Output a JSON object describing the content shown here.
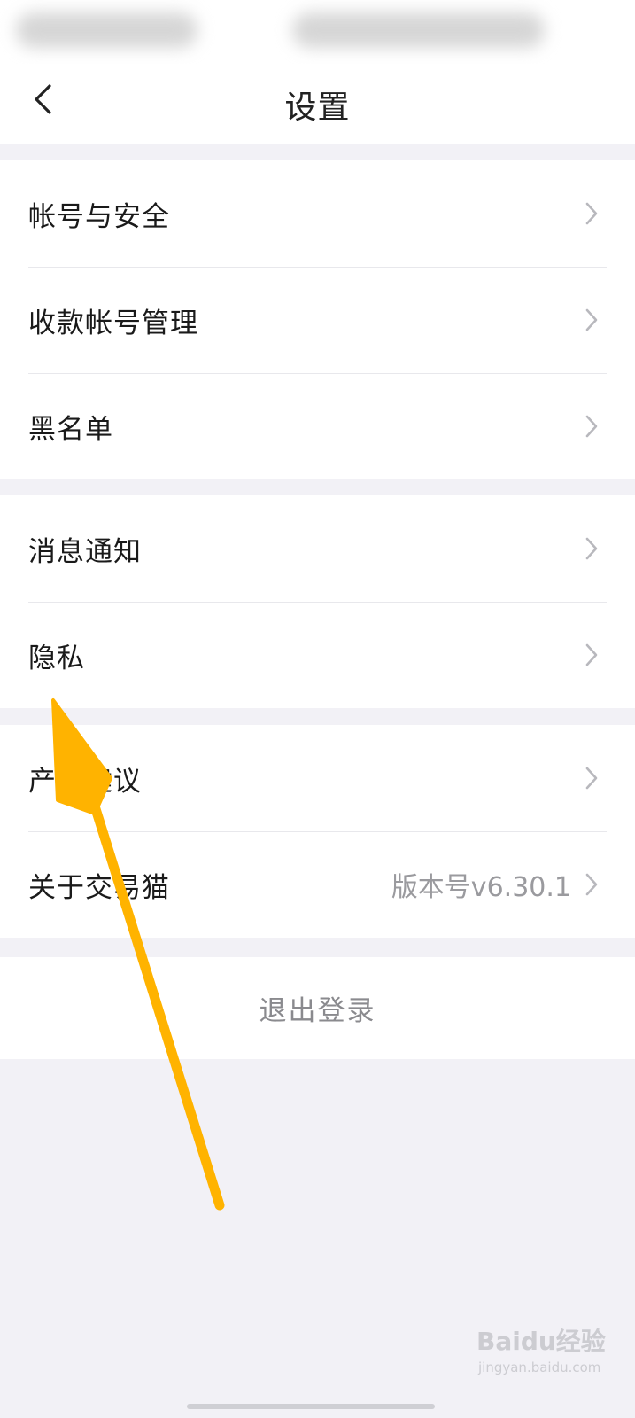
{
  "header": {
    "title": "设置",
    "back_icon": "chevron-left-icon"
  },
  "groups": [
    {
      "items": [
        {
          "label": "帐号与安全"
        },
        {
          "label": "收款帐号管理"
        },
        {
          "label": "黑名单"
        }
      ]
    },
    {
      "items": [
        {
          "label": "消息通知"
        },
        {
          "label": "隐私"
        }
      ]
    },
    {
      "items": [
        {
          "label": "产品建议"
        },
        {
          "label": "关于交易猫",
          "value": "版本号v6.30.1"
        }
      ]
    }
  ],
  "logout": {
    "label": "退出登录"
  },
  "watermark": {
    "main": "Baidu经验",
    "sub": "jingyan.baidu.com"
  },
  "colors": {
    "page_background": "#f2f1f6",
    "card_background": "#ffffff",
    "annotation_arrow": "#ffb300",
    "muted_text": "#9a9a9e"
  }
}
